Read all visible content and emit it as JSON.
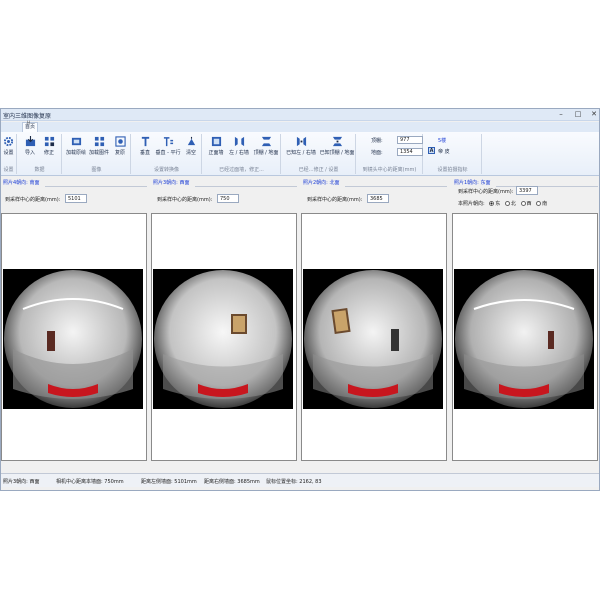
{
  "window": {
    "title": "室内三维图像复原"
  },
  "window_controls": {
    "minimize": "–",
    "maximize": "□",
    "close": "✕"
  },
  "tabs": {
    "home": "首页",
    "letter": "H"
  },
  "ribbon": {
    "settings": {
      "label": "设置",
      "group_label": "设置"
    },
    "data": {
      "import_label": "导入",
      "correct_label": "修正",
      "group_label": "数据"
    },
    "image": {
      "load_label": "加载原绘",
      "load_image_label": "加载图件",
      "restore_label": "复原",
      "group_label": "图像"
    },
    "transform": {
      "vertical_label": "垂直",
      "vertical_parallel_label": "垂直 - 平行",
      "clear_label": "清空",
      "group_label": "设置转换像"
    },
    "correction": {
      "front_wall_label": "正面墙",
      "left_right_label": "左 / 右墙",
      "ceiling_floor_label": "顶棚 / 地面",
      "group_label": "已经过面墙，修正..."
    },
    "known_correction": {
      "known_left_right_label": "已知左 / 右墙",
      "known_ceiling_floor_label": "已知顶棚 / 地面",
      "group_label": "已经…修正 / 设置"
    },
    "distance": {
      "ceiling_label": "顶棚:",
      "ceiling_value": "977",
      "floor_label": "地面:",
      "floor_value": "1354",
      "group_label": "到镜头中心的距离(mm)"
    },
    "orientation": {
      "floor_label": "5楼",
      "flag_label": "A",
      "direction_label": "帝 皮",
      "group_label": "设置拍摄指标"
    }
  },
  "panels": [
    {
      "header": "照片4朝向: 南面",
      "distance_label": "到采样中心的距离(mm):",
      "distance_value": "5101"
    },
    {
      "header": "照片3朝向: 西面",
      "distance_label": "到采样中心的距离(mm):",
      "distance_value": "750"
    },
    {
      "header": "照片2朝向: 北面",
      "distance_label": "到采样中心的距离(mm):",
      "distance_value": "3685"
    },
    {
      "header": "照片1朝向: 东面",
      "distance_label": "到采样中心的距离(mm):",
      "distance_value": "3397",
      "direction_label": "本照片朝向:",
      "direction_options": [
        "东",
        "北",
        "西",
        "南"
      ],
      "direction_selected": "东"
    }
  ],
  "statusbar": {
    "photo": "照片3朝向: 西面",
    "center_distance": "相机中心距离本墙面: 750mm",
    "left_wall": "距离左侧墙面: 5101mm",
    "right_wall": "距离右侧墙面: 3685mm",
    "coords": "鼠标位置坐标: 2162, 83"
  },
  "colors": {
    "accent": "#1e3fd6",
    "ribbon_icon": "#2f5fb4",
    "title_bar": "#dfe9f6",
    "chair": "#c8161e",
    "photo_background": "#000000"
  },
  "icons": [
    "gear-icon",
    "import-icon",
    "correct-icon",
    "load-icon",
    "load-image-icon",
    "restore-icon",
    "vertical-icon",
    "vertical-parallel-icon",
    "clear-icon",
    "front-wall-icon",
    "left-right-wall-icon",
    "ceiling-floor-icon",
    "known-left-right-icon",
    "known-ceiling-floor-icon"
  ]
}
